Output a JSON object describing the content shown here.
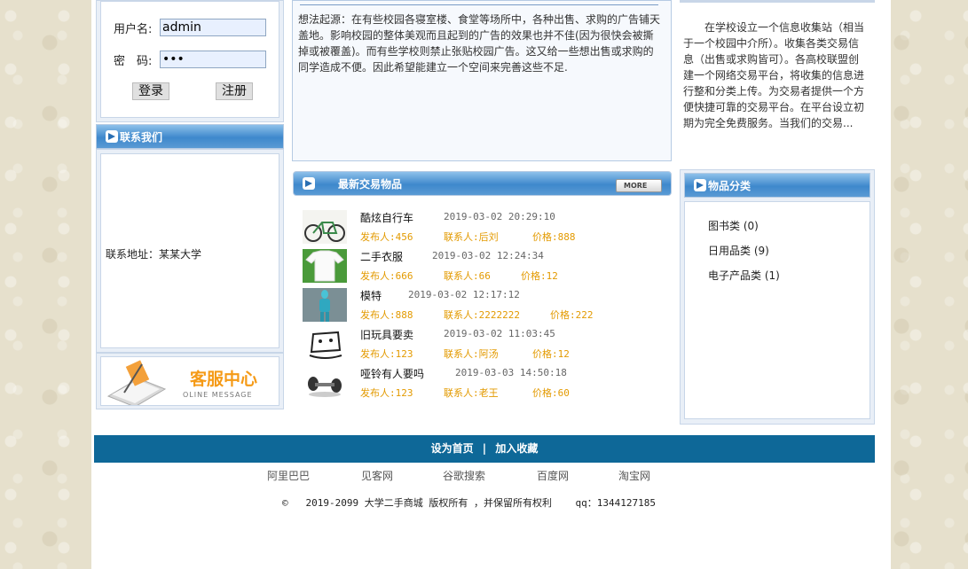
{
  "login": {
    "username_label": "用户名:",
    "username_value": "admin",
    "password_label": "密　码:",
    "password_value": "•••",
    "login_button": "登录",
    "register_button": "注册"
  },
  "contact": {
    "title": "联系我们",
    "address": "联系地址：某某大学"
  },
  "service": {
    "title": "客服中心",
    "subtitle": "OLINE MESSAGE"
  },
  "origin": {
    "text": "想法起源：在有些校园各寝室楼、食堂等场所中，各种出售、求购的广告铺天盖地。影响校园的整体美观而且起到的广告的效果也并不佳(因为很快会被撕掉或被覆盖)。而有些学校则禁止张贴校园广告。这又给一些想出售或求购的同学造成不便。因此希望能建立一个空间来完善这些不足."
  },
  "latest": {
    "title": "最新交易物品",
    "more_label": "MORE",
    "items": [
      {
        "name": "酷炫自行车",
        "time": "2019-03-02 20:29:10",
        "publisher": "发布人:456",
        "contact": "联系人:后刘",
        "price": "价格:888",
        "icon": "bicycle-image"
      },
      {
        "name": "二手衣服",
        "time": "2019-03-02 12:24:34",
        "publisher": "发布人:666",
        "contact": "联系人:66",
        "price": "价格:12",
        "icon": "tshirt-image"
      },
      {
        "name": "模特",
        "time": "2019-03-02 12:17:12",
        "publisher": "发布人:888",
        "contact": "联系人:2222222",
        "price": "价格:222",
        "icon": "mannequin-image"
      },
      {
        "name": "旧玩具要卖",
        "time": "2019-03-02 11:03:45",
        "publisher": "发布人:123",
        "contact": "联系人:阿汤",
        "price": "价格:12",
        "icon": "toy-image"
      },
      {
        "name": "哑铃有人要吗",
        "time": "2019-03-03 14:50:18",
        "publisher": "发布人:123",
        "contact": "联系人:老王",
        "price": "价格:60",
        "icon": "dumbbell-image"
      }
    ]
  },
  "intro": {
    "text": "在学校设立一个信息收集站（相当于一个校园中介所）。收集各类交易信息（出售或求购皆可）。各高校联盟创建一个网络交易平台，将收集的信息进行整和分类上传。为交易者提供一个方便快捷可靠的交易平台。在平台设立初期为完全免费服务。当我们的交易..."
  },
  "categories": {
    "title": "物品分类",
    "items": [
      {
        "label": "图书类 (0)"
      },
      {
        "label": "日用品类 (9)"
      },
      {
        "label": "电子产品类 (1)"
      }
    ]
  },
  "footer": {
    "set_home": "设为首页",
    "separator": "|",
    "add_favorite": "加入收藏",
    "links": [
      "阿里巴巴",
      "见客网",
      "谷歌搜索",
      "百度网",
      "淘宝网"
    ],
    "copyright_symbol": "©",
    "copyright": "2019-2099 大学二手商城 版权所有 ，并保留所有权利",
    "qq": "qq：1344127185"
  }
}
